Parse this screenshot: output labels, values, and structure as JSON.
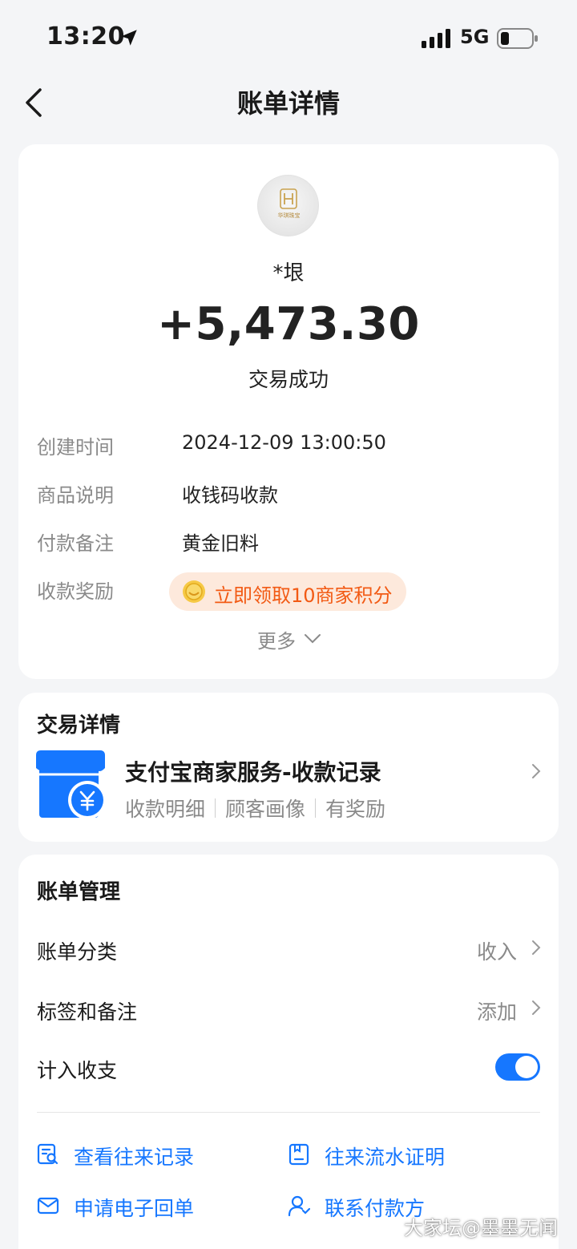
{
  "status_bar": {
    "time": "13:20",
    "network": "5G"
  },
  "nav": {
    "title": "账单详情"
  },
  "summary": {
    "payer": "*垠",
    "amount": "+5,473.30",
    "status": "交易成功",
    "avatar_text": "华琪珠宝"
  },
  "details": [
    {
      "label": "创建时间",
      "value": "2024-12-09 13:00:50"
    },
    {
      "label": "商品说明",
      "value": "收钱码收款"
    },
    {
      "label": "付款备注",
      "value": "黄金旧料"
    }
  ],
  "reward": {
    "label": "收款奖励",
    "text": "立即领取10商家积分"
  },
  "more": "更多",
  "trade": {
    "section_title": "交易详情",
    "title": "支付宝商家服务-收款记录",
    "tags": [
      "收款明细",
      "顾客画像",
      "有奖励"
    ]
  },
  "manage": {
    "section_title": "账单管理",
    "category_label": "账单分类",
    "category_value": "收入",
    "tags_label": "标签和备注",
    "tags_value": "添加",
    "count_label": "计入收支",
    "count_enabled": true
  },
  "actions": [
    {
      "label": "查看往来记录",
      "icon": "record-search-icon"
    },
    {
      "label": "往来流水证明",
      "icon": "document-icon"
    },
    {
      "label": "申请电子回单",
      "icon": "mail-icon"
    },
    {
      "label": "联系付款方",
      "icon": "contact-person-icon"
    }
  ],
  "watermark": "大家坛@墨墨无闻",
  "colors": {
    "accent": "#1677ff",
    "reward_text": "#f25a14",
    "reward_bg": "#fde9dc"
  }
}
